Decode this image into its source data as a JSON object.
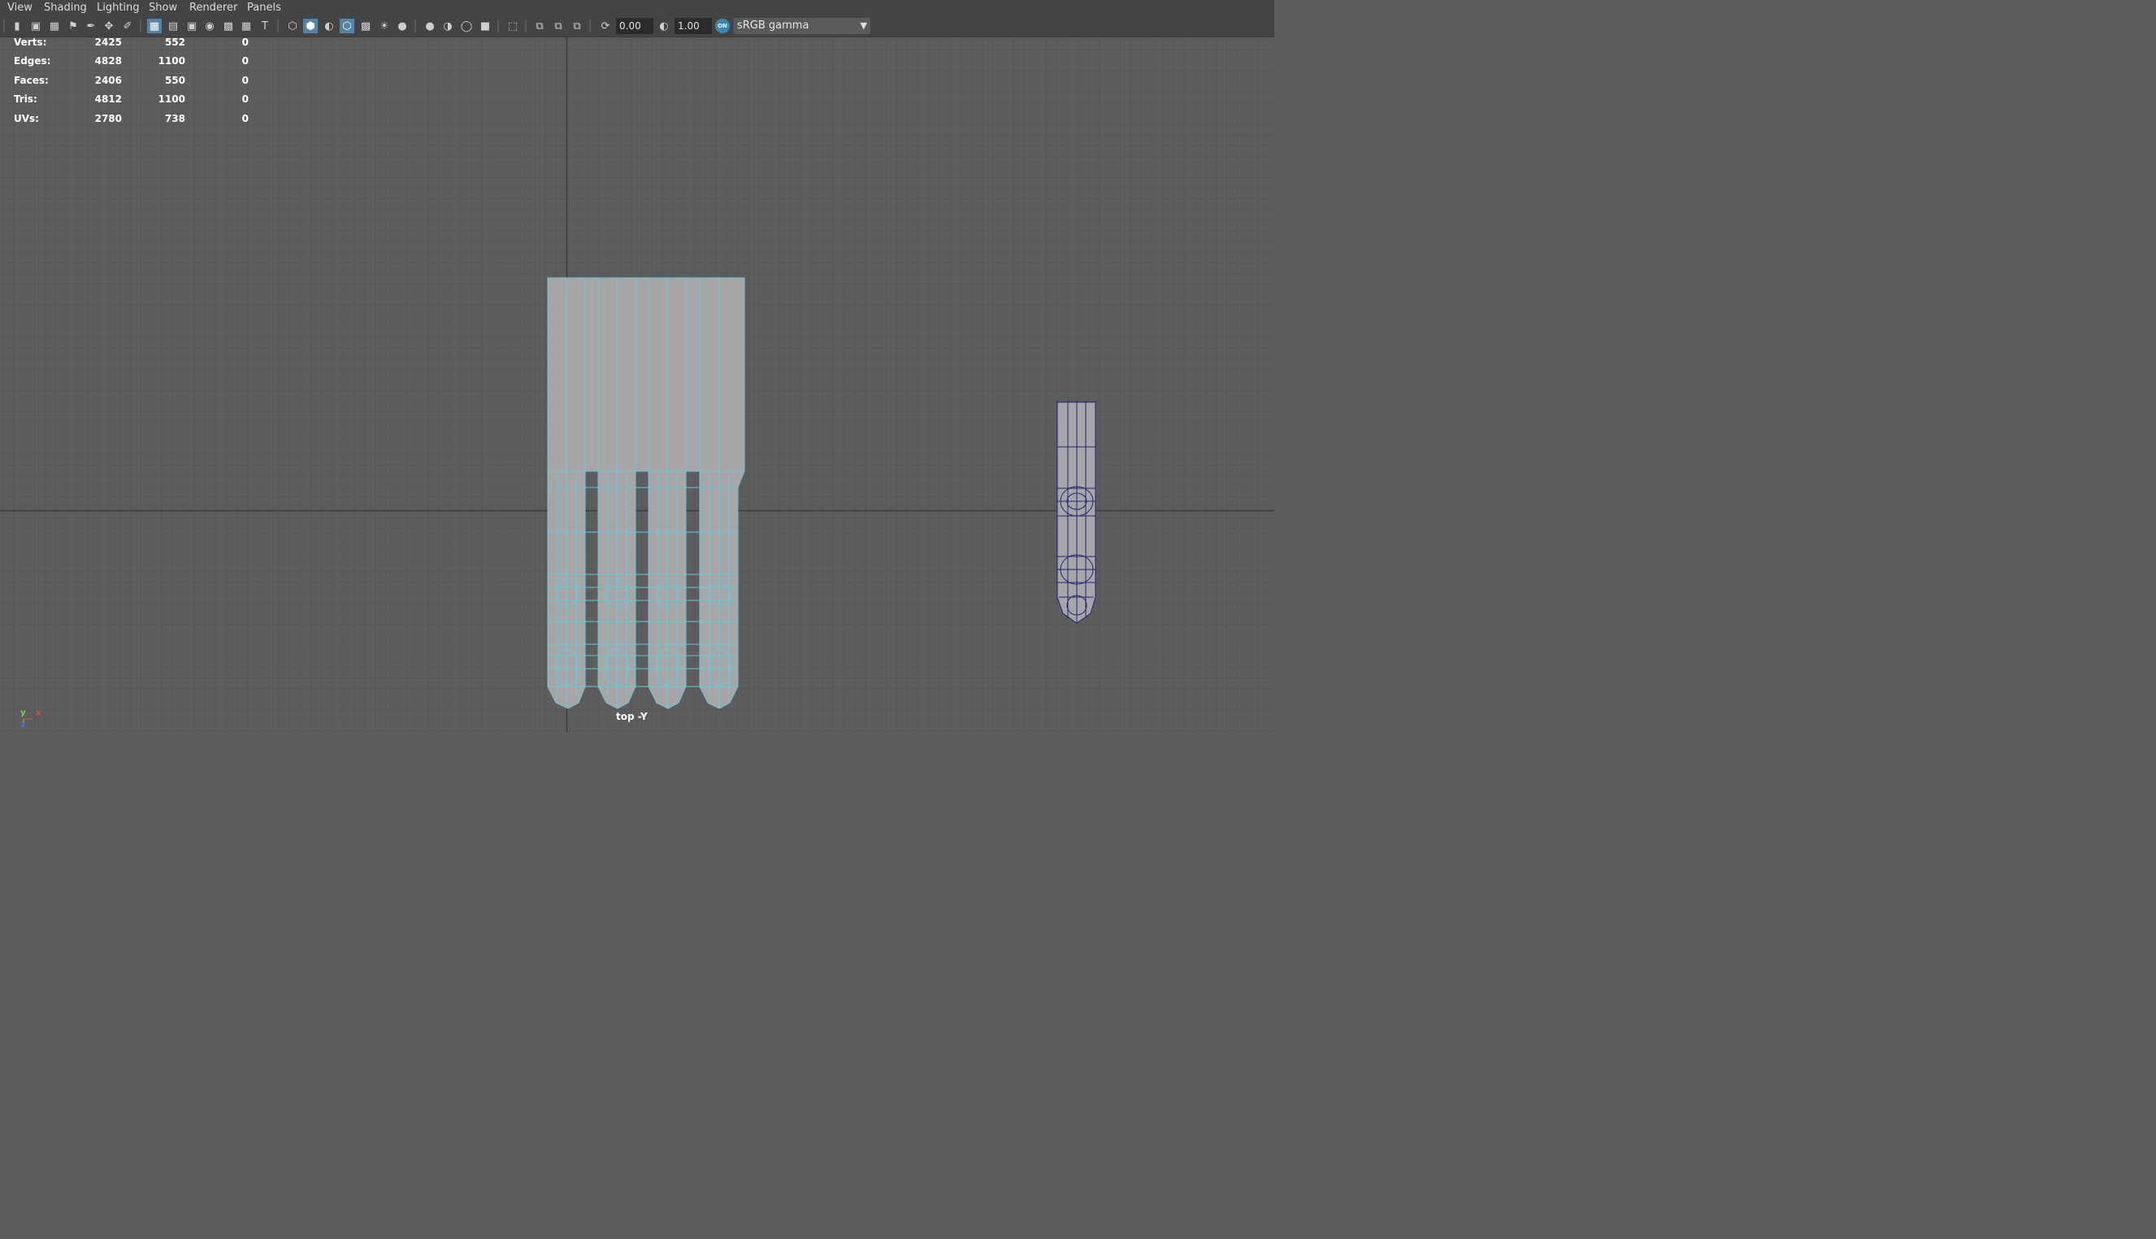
{
  "menu": [
    "View",
    "Shading",
    "Lighting",
    "Show",
    "Renderer",
    "Panels"
  ],
  "toolbar": {
    "exposure_value": "0.00",
    "gamma_value": "1.00",
    "color_management_badge": "ON",
    "color_space": "sRGB gamma",
    "icons": [
      "select-camera-icon",
      "camera-attributes-icon",
      "bookmarks-icon",
      "image-plane-icon",
      "grease-pencil-icon",
      "two-d-pan-icon",
      "grid-icon",
      "film-gate-icon",
      "resolution-gate-icon",
      "gate-mask-icon",
      "field-chart-icon",
      "safe-action-icon",
      "safe-title-icon",
      "wireframe-icon",
      "smooth-shade-icon",
      "default-material-icon",
      "wireframe-on-shaded-icon",
      "xray-icon",
      "use-all-lights-icon",
      "shadows-icon",
      "screen-space-ao-icon",
      "motion-blur-icon",
      "anti-aliasing-icon",
      "depth-of-field-icon",
      "isolate-select-icon",
      "xray-joints-icon",
      "xray-active-icon",
      "backface-icon",
      "exposure-icon",
      "gamma-icon"
    ]
  },
  "hud": {
    "rows": [
      {
        "label": "Verts:",
        "a": "2425",
        "b": "552",
        "c": "0"
      },
      {
        "label": "Edges:",
        "a": "4828",
        "b": "1100",
        "c": "0"
      },
      {
        "label": "Faces:",
        "a": "2406",
        "b": "550",
        "c": "0"
      },
      {
        "label": "Tris:",
        "a": "4812",
        "b": "1100",
        "c": "0"
      },
      {
        "label": "UVs:",
        "a": "2780",
        "b": "738",
        "c": "0"
      }
    ]
  },
  "camera_label": "top -Y",
  "axis": {
    "y": "y",
    "x": "x",
    "z": "z"
  },
  "colors": {
    "ui_bg": "#444444",
    "viewport_bg": "#5d5d5d",
    "grid_line": "#505050",
    "axis_line": "#3c3c3c",
    "selected_wire": "#68c8dc",
    "unselected_wire": "#23237a",
    "mesh_fill": "#a6a6a6",
    "active_button": "#5285a6"
  }
}
